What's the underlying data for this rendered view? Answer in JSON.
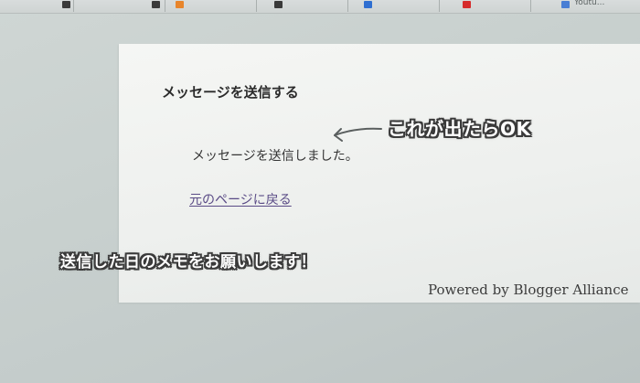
{
  "browser": {
    "tabs": [
      {
        "title": "",
        "favicon_color": "#3a3a3a"
      },
      {
        "title": "",
        "favicon_color": "#3a3a3a"
      },
      {
        "title": "",
        "favicon_color": "#e8852b"
      },
      {
        "title": "",
        "favicon_color": "#2f6fd1"
      },
      {
        "title": "",
        "favicon_color": "#d62b2b"
      },
      {
        "title": "Youtu...",
        "favicon_color": "#4a7fd4"
      }
    ]
  },
  "page": {
    "title": "メッセージを送信する",
    "message": "メッセージを送信しました。",
    "back_link": "元のページに戻る",
    "footer": "Powered by Blogger Alliance"
  },
  "annotations": {
    "ok_caption": "これが出たらOK",
    "memo_caption": "送信した日のメモをお願いします！"
  },
  "colors": {
    "link": "#5a4b86",
    "caption_fill": "#ffffff",
    "caption_outline": "#3a3a3a"
  }
}
